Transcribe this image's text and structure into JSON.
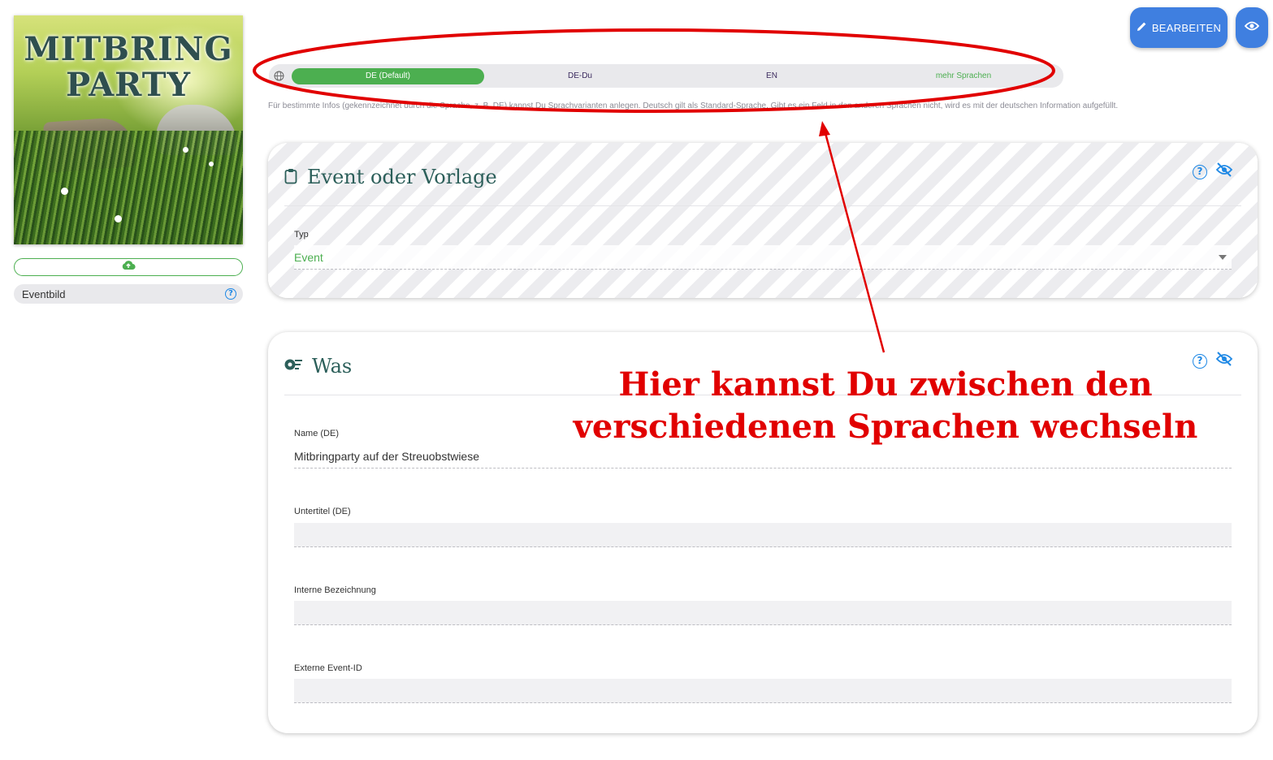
{
  "event_image": {
    "title_line1": "MITBRING",
    "title_line2": "PARTY"
  },
  "upload": {
    "icon": "cloud-upload-icon"
  },
  "eventbild": {
    "label": "Eventbild",
    "help_icon": "?"
  },
  "toolbar": {
    "edit_label": "BEARBEITEN",
    "edit_icon": "pencil-icon",
    "view_icon": "eye-icon"
  },
  "languages": {
    "icon": "globe-icon",
    "tabs": [
      {
        "label": "DE (Default)",
        "active": true
      },
      {
        "label": "DE-Du",
        "active": false
      },
      {
        "label": "EN",
        "active": false
      },
      {
        "label": "mehr Sprachen",
        "active": false
      }
    ],
    "info": "Für bestimmte Infos (gekennzeichnet durch die Sprache, z. B. DE) kannst Du Sprachvarianten anlegen. Deutsch gilt als Standard-Sprache. Gibt es ein Feld in den anderen Sprachen nicht, wird es mit der deutschen Information aufgefüllt."
  },
  "annotation": {
    "line1": "Hier kannst Du zwischen den",
    "line2": "verschiedenen Sprachen wechseln",
    "color": "#e10000"
  },
  "card_event": {
    "title": "Event oder Vorlage",
    "icon": "clipboard-icon",
    "type_label": "Typ",
    "type_value": "Event"
  },
  "card_was": {
    "title": "Was",
    "icon": "was-icon",
    "name_label": "Name (DE)",
    "name_value": "Mitbringparty auf der Streuobstwiese",
    "subtitle_label": "Untertitel (DE)",
    "subtitle_value": "",
    "internal_label": "Interne Bezeichnung",
    "internal_value": "",
    "external_label": "Externe Event-ID",
    "external_value": ""
  },
  "colors": {
    "accent_blue": "#3f7fe0",
    "accent_green": "#4caf50",
    "heading": "#2c5f5a"
  }
}
